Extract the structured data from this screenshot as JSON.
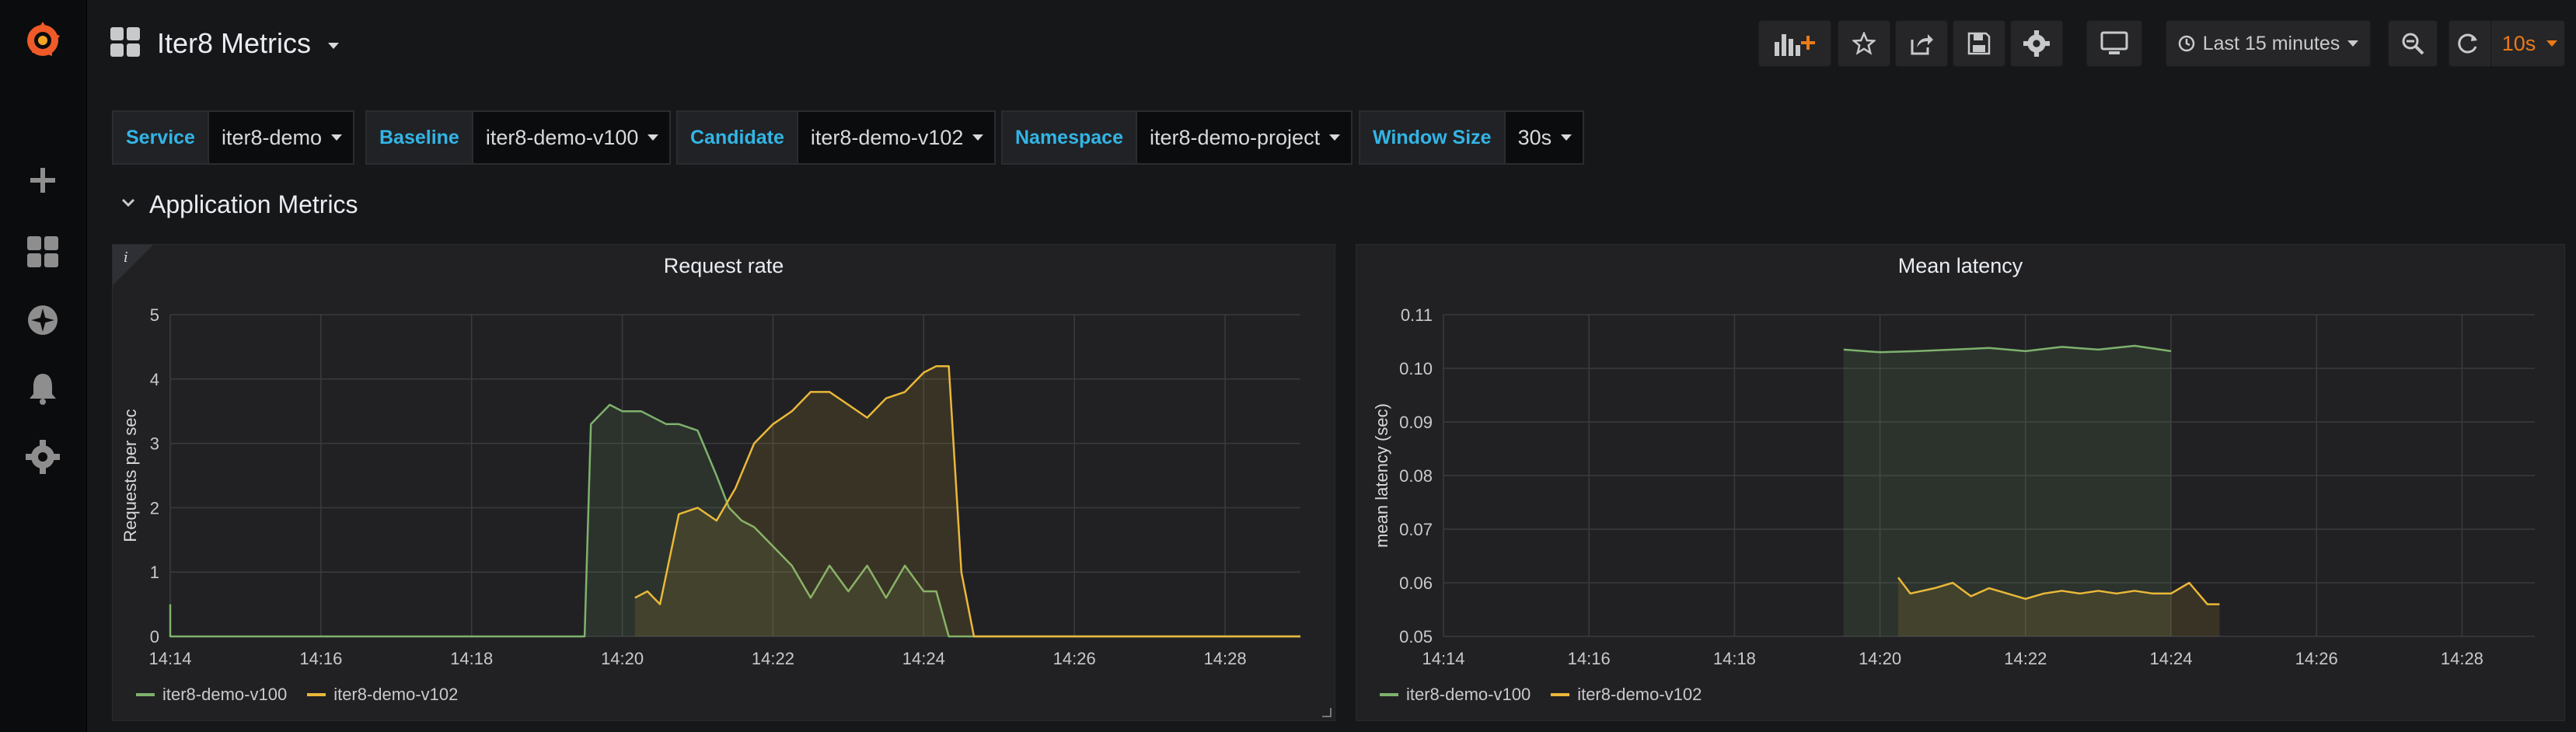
{
  "navbar": {
    "title": "Iter8 Metrics",
    "time_range": "Last 15 minutes",
    "refresh_interval": "10s"
  },
  "variables": [
    {
      "label": "Service",
      "value": "iter8-demo"
    },
    {
      "label": "Baseline",
      "value": "iter8-demo-v100"
    },
    {
      "label": "Candidate",
      "value": "iter8-demo-v102"
    },
    {
      "label": "Namespace",
      "value": "iter8-demo-project"
    },
    {
      "label": "Window Size",
      "value": "30s"
    }
  ],
  "row": {
    "title": "Application Metrics"
  },
  "colors": {
    "series_v100": "#7eb26d",
    "series_v102": "#eab839",
    "accent": "#33b5e5",
    "refresh": "#eb7b18"
  },
  "panels": [
    {
      "title": "Request rate",
      "legend": [
        "iter8-demo-v100",
        "iter8-demo-v102"
      ]
    },
    {
      "title": "Mean latency",
      "legend": [
        "iter8-demo-v100",
        "iter8-demo-v102"
      ]
    }
  ],
  "chart_data": [
    {
      "type": "line",
      "title": "Request rate",
      "ylabel": "Requests per sec",
      "xlabel": "",
      "xlim": [
        "14:14",
        "14:29"
      ],
      "ylim": [
        0,
        5
      ],
      "x_ticks": [
        "14:14",
        "14:16",
        "14:18",
        "14:20",
        "14:22",
        "14:24",
        "14:26",
        "14:28"
      ],
      "y_ticks": [
        "0",
        "1",
        "2",
        "3",
        "4",
        "5"
      ],
      "grid": true,
      "legend_position": "bottom-left",
      "series": [
        {
          "name": "iter8-demo-v100",
          "color": "#7eb26d",
          "x": [
            "14:14",
            "14:14",
            "14:19:30",
            "14:19:35",
            "14:19:50",
            "14:20",
            "14:20:15",
            "14:20:35",
            "14:20:45",
            "14:21",
            "14:21:15",
            "14:21:25",
            "14:21:35",
            "14:21:45",
            "14:22",
            "14:22:15",
            "14:22:30",
            "14:22:45",
            "14:23",
            "14:23:15",
            "14:23:30",
            "14:23:45",
            "14:24",
            "14:24:10",
            "14:24:20",
            "14:29"
          ],
          "y": [
            0.5,
            0,
            0,
            3.3,
            3.6,
            3.5,
            3.5,
            3.3,
            3.3,
            3.2,
            2.5,
            2.0,
            1.8,
            1.7,
            1.4,
            1.1,
            0.6,
            1.1,
            0.7,
            1.1,
            0.6,
            1.1,
            0.7,
            0.7,
            0,
            0
          ]
        },
        {
          "name": "iter8-demo-v102",
          "color": "#eab839",
          "x": [
            "14:20:10",
            "14:20:20",
            "14:20:30",
            "14:20:45",
            "14:21",
            "14:21:15",
            "14:21:30",
            "14:21:45",
            "14:22",
            "14:22:15",
            "14:22:30",
            "14:22:45",
            "14:23",
            "14:23:15",
            "14:23:30",
            "14:23:45",
            "14:24",
            "14:24:10",
            "14:24:20",
            "14:24:30",
            "14:24:40",
            "14:29"
          ],
          "y": [
            0.6,
            0.7,
            0.5,
            1.9,
            2.0,
            1.8,
            2.3,
            3.0,
            3.3,
            3.5,
            3.8,
            3.8,
            3.6,
            3.4,
            3.7,
            3.8,
            4.1,
            4.2,
            4.2,
            1.0,
            0,
            0
          ]
        }
      ]
    },
    {
      "type": "line",
      "title": "Mean latency",
      "ylabel": "mean latency (sec)",
      "xlabel": "",
      "xlim": [
        "14:14",
        "14:29"
      ],
      "ylim": [
        0.05,
        0.11
      ],
      "x_ticks": [
        "14:14",
        "14:16",
        "14:18",
        "14:20",
        "14:22",
        "14:24",
        "14:26",
        "14:28"
      ],
      "y_ticks": [
        "0.05",
        "0.06",
        "0.07",
        "0.08",
        "0.09",
        "0.10",
        "0.11"
      ],
      "grid": true,
      "legend_position": "bottom-left",
      "series": [
        {
          "name": "iter8-demo-v100",
          "color": "#7eb26d",
          "x": [
            "14:19:30",
            "14:20",
            "14:20:30",
            "14:21",
            "14:21:30",
            "14:22",
            "14:22:30",
            "14:23",
            "14:23:30",
            "14:24"
          ],
          "y": [
            0.1035,
            0.103,
            0.1032,
            0.1035,
            0.1038,
            0.1032,
            0.104,
            0.1035,
            0.1042,
            0.1032
          ]
        },
        {
          "name": "iter8-demo-v102",
          "color": "#eab839",
          "x": [
            "14:20:15",
            "14:20:25",
            "14:20:45",
            "14:21",
            "14:21:15",
            "14:21:30",
            "14:21:45",
            "14:22",
            "14:22:15",
            "14:22:30",
            "14:22:45",
            "14:23",
            "14:23:15",
            "14:23:30",
            "14:23:45",
            "14:24",
            "14:24:15",
            "14:24:30",
            "14:24:40"
          ],
          "y": [
            0.061,
            0.058,
            0.059,
            0.06,
            0.0575,
            0.059,
            0.058,
            0.057,
            0.058,
            0.0585,
            0.058,
            0.0585,
            0.058,
            0.0585,
            0.058,
            0.058,
            0.06,
            0.056,
            0.056
          ]
        }
      ]
    }
  ]
}
